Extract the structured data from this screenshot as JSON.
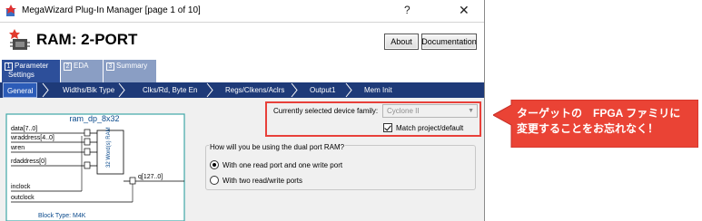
{
  "window": {
    "title": "MegaWizard Plug-In Manager [page 1 of 10]",
    "help_glyph": "?",
    "close_glyph": "✕"
  },
  "header": {
    "title": "RAM: 2-PORT",
    "about_label": "About",
    "documentation_label": "Documentation"
  },
  "tabs": [
    {
      "num": "1",
      "label_line1": "Parameter",
      "label_line2": "Settings",
      "active": true
    },
    {
      "num": "2",
      "label_line1": "EDA",
      "label_line2": "",
      "active": false
    },
    {
      "num": "3",
      "label_line1": "Summary",
      "label_line2": "",
      "active": false
    }
  ],
  "steps": [
    {
      "label": "General",
      "active": true
    },
    {
      "label": "Widths/Blk Type"
    },
    {
      "label": "Clks/Rd, Byte En"
    },
    {
      "label": "Regs/Clkens/Aclrs"
    },
    {
      "label": "Output1"
    },
    {
      "label": "Mem Init"
    }
  ],
  "diagram": {
    "name": "ram_dp_8x32",
    "ports": [
      "data[7..0]",
      "wraddress[4..0]",
      "wren",
      "rdaddress[0]",
      "inclock",
      "outclock"
    ],
    "output_port": "q[127..0]",
    "ram_label": "32 Word(s) RAM",
    "block_type": "Block Type: M4K"
  },
  "device": {
    "family_label": "Currently selected device family:",
    "family_value": "Cyclone II",
    "match_label": "Match project/default",
    "match_checked": true
  },
  "usage": {
    "question": "How will you be using the dual port RAM?",
    "options": [
      {
        "label": "With one read port and one write port",
        "selected": true
      },
      {
        "label": "With two read/write ports",
        "selected": false
      }
    ]
  },
  "callout": {
    "line1": "ターゲットの　FPGA ファミリに",
    "line2": "変更することをお忘れなく！"
  },
  "colors": {
    "tab_active": "#2d4f9a",
    "tab_inactive": "#8a9ec4",
    "step_bar": "#1e3a78",
    "diagram_border": "#3fa7a7",
    "highlight_frame": "#e8403a",
    "callout_fill": "#ea4335"
  },
  "icons": {
    "app": "wizard-icon",
    "header": "chip-wizard-icon"
  }
}
